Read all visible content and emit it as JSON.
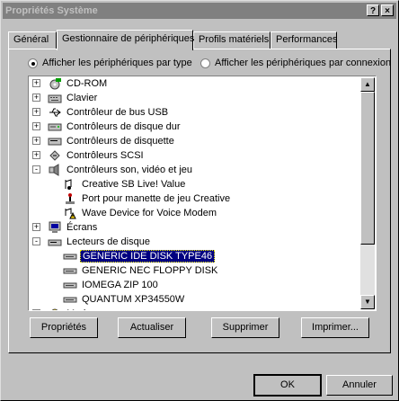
{
  "window": {
    "title": "Propriétés Système",
    "help_button": "?",
    "close_button": "×"
  },
  "tabs": [
    "Général",
    "Gestionnaire de périphériques",
    "Profils matériels",
    "Performances"
  ],
  "view": {
    "by_type": "Afficher les périphériques par type",
    "by_connection": "Afficher les périphériques par connexion",
    "selected": "by_type"
  },
  "tree": [
    {
      "label": "CD-ROM",
      "level": 0,
      "expander": "+",
      "icon": "cdrom-icon"
    },
    {
      "label": "Clavier",
      "level": 0,
      "expander": "+",
      "icon": "keyboard-icon"
    },
    {
      "label": "Contrôleur de bus USB",
      "level": 0,
      "expander": "+",
      "icon": "usb-icon"
    },
    {
      "label": "Contrôleurs de disque dur",
      "level": 0,
      "expander": "+",
      "icon": "hdd-controller-icon"
    },
    {
      "label": "Contrôleurs de disquette",
      "level": 0,
      "expander": "+",
      "icon": "floppy-controller-icon"
    },
    {
      "label": "Contrôleurs SCSI",
      "level": 0,
      "expander": "+",
      "icon": "scsi-icon"
    },
    {
      "label": "Contrôleurs son, vidéo et jeu",
      "level": 0,
      "expander": "-",
      "icon": "sound-icon"
    },
    {
      "label": "Creative SB Live! Value",
      "level": 1,
      "expander": "",
      "icon": "sound-device-icon"
    },
    {
      "label": "Port pour manette de jeu Creative",
      "level": 1,
      "expander": "",
      "icon": "joystick-icon"
    },
    {
      "label": "Wave Device for Voice Modem",
      "level": 1,
      "expander": "",
      "icon": "warning-device-icon"
    },
    {
      "label": "Écrans",
      "level": 0,
      "expander": "+",
      "icon": "monitor-icon"
    },
    {
      "label": "Lecteurs de disque",
      "level": 0,
      "expander": "-",
      "icon": "disk-drive-icon"
    },
    {
      "label": "GENERIC IDE  DISK TYPE46",
      "level": 1,
      "expander": "",
      "icon": "disk-icon",
      "selected": true
    },
    {
      "label": "GENERIC NEC  FLOPPY DISK",
      "level": 1,
      "expander": "",
      "icon": "disk-icon"
    },
    {
      "label": "IOMEGA ZIP 100",
      "level": 1,
      "expander": "",
      "icon": "disk-icon"
    },
    {
      "label": "QUANTUM XP34550W",
      "level": 1,
      "expander": "",
      "icon": "disk-icon"
    },
    {
      "label": "Modem",
      "level": 0,
      "expander": "+",
      "icon": "modem-icon"
    }
  ],
  "buttons": {
    "properties": "Propriétés",
    "refresh": "Actualiser",
    "remove": "Supprimer",
    "print": "Imprimer...",
    "ok": "OK",
    "cancel": "Annuler"
  }
}
